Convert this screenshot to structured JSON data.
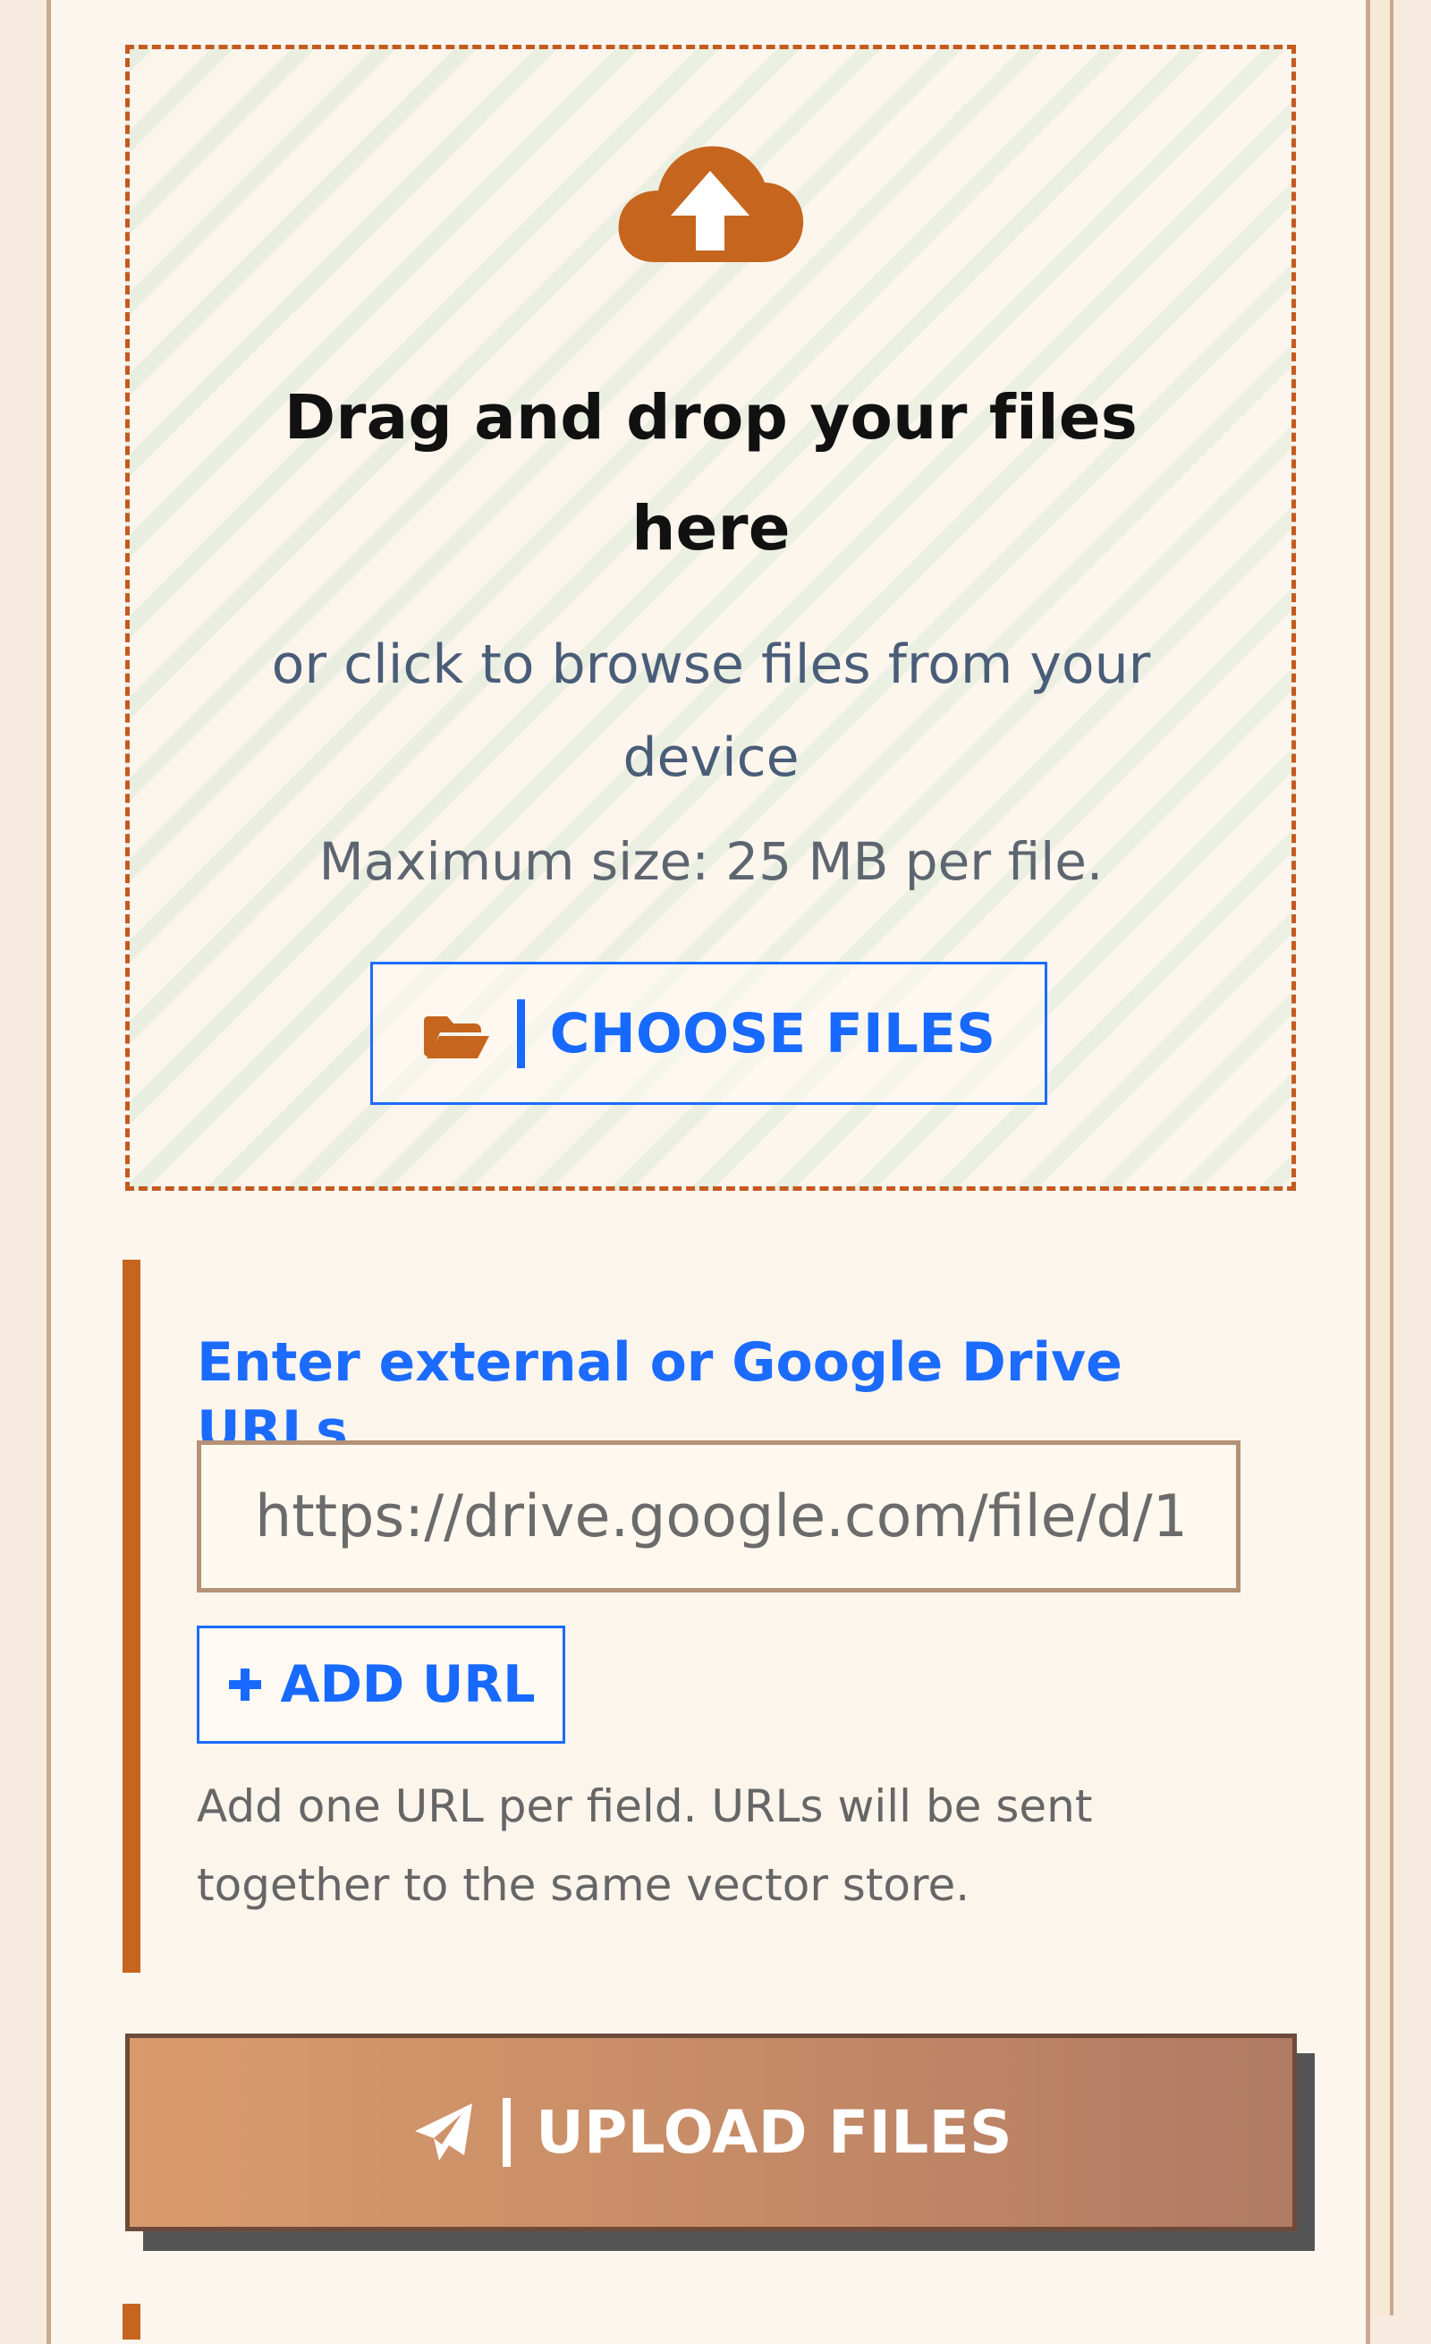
{
  "dropzone": {
    "title": "Drag and drop your files here",
    "subtitle": "or click to browse files from your device",
    "max_size": "Maximum size: 25 MB per file.",
    "choose_button": "CHOOSE FILES",
    "icon": "cloud-upload-icon"
  },
  "url_section": {
    "heading": "Enter external or Google Drive URLs",
    "placeholder": "https://drive.google.com/file/d/1",
    "add_button": "ADD URL",
    "help_text": "Add one URL per field. URLs will be sent together to the same vector store."
  },
  "upload_button": "UPLOAD FILES",
  "colors": {
    "accent": "#c6651e",
    "link_blue": "#1c6bff",
    "upload_gradient_start": "#d99b6d",
    "upload_gradient_end": "#b17a63"
  },
  "icons": {
    "folder": "folder-open-icon",
    "plus": "plus-icon",
    "send": "paper-plane-icon"
  }
}
